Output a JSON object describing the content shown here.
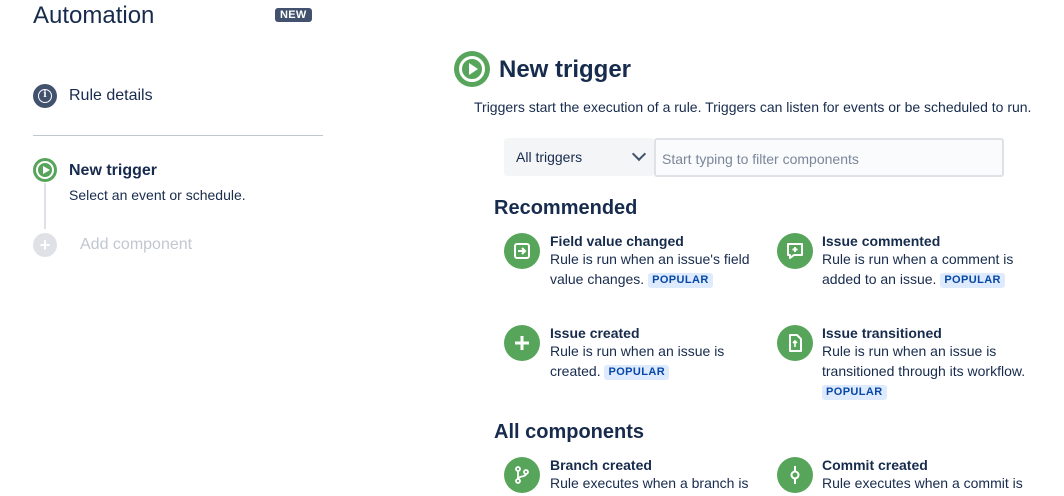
{
  "sidebar": {
    "title": "Automation",
    "badge": "NEW",
    "steps": {
      "rule_details": "Rule details",
      "new_trigger": "New trigger",
      "new_trigger_sub": "Select an event or schedule.",
      "add_component": "Add component"
    }
  },
  "main": {
    "title": "New trigger",
    "description": "Triggers start the execution of a rule. Triggers can listen for events or be scheduled to run.",
    "filter_select": "All triggers",
    "filter_placeholder": "Start typing to filter components",
    "recommended_heading": "Recommended",
    "all_components_heading": "All components",
    "popular_label": "POPULAR",
    "recommended": [
      {
        "title": "Field value changed",
        "desc": "Rule is run when an issue's field value changes.",
        "icon": "field-change-icon"
      },
      {
        "title": "Issue commented",
        "desc": "Rule is run when a comment is added to an issue.",
        "icon": "comment-icon"
      },
      {
        "title": "Issue created",
        "desc": "Rule is run when an issue is created.",
        "icon": "plus-icon"
      },
      {
        "title": "Issue transitioned",
        "desc": "Rule is run when an issue is transitioned through its workflow.",
        "icon": "transition-icon"
      }
    ],
    "all_components": [
      {
        "title": "Branch created",
        "desc": "Rule executes when a branch is",
        "icon": "branch-icon"
      },
      {
        "title": "Commit created",
        "desc": "Rule executes when a commit is",
        "icon": "commit-icon"
      }
    ]
  },
  "colors": {
    "accent_green": "#57a55a",
    "text": "#172b4d",
    "badge_bg": "#42526e",
    "popular_bg": "#deebff",
    "popular_text": "#0747a6"
  }
}
